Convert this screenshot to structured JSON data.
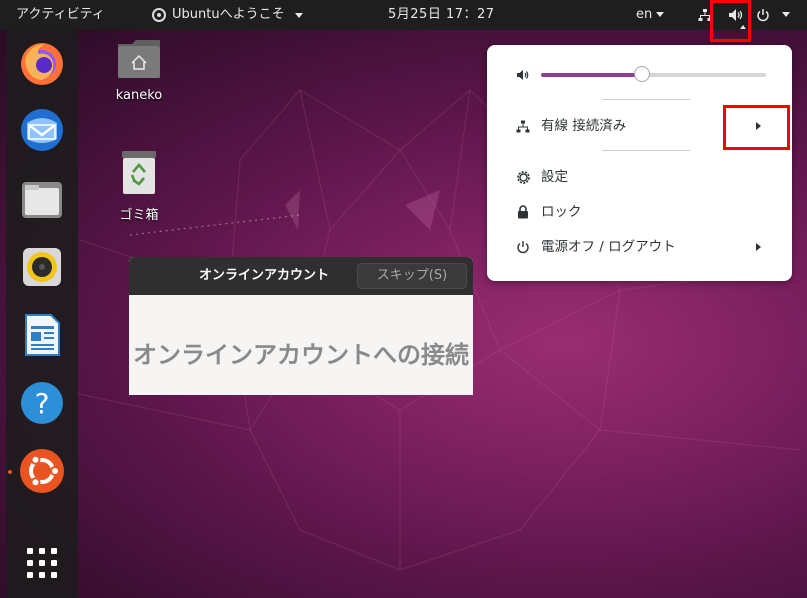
{
  "topbar": {
    "activities": "アクティビティ",
    "app_menu": "Ubuntuへようこそ",
    "clock": "5月25日  17：27",
    "lang": "en"
  },
  "desktop": {
    "home_label": "kaneko",
    "trash_label": "ゴミ箱"
  },
  "dock": {
    "items": [
      "firefox",
      "thunderbird",
      "files",
      "rhythmbox",
      "libreoffice-writer",
      "help",
      "ubuntu-software",
      "show-applications"
    ]
  },
  "online_accounts": {
    "title": "オンラインアカウント",
    "skip_label": "スキップ(S)",
    "heading": "オンラインアカウントへの接続"
  },
  "system_menu": {
    "volume_level": 0.45,
    "wired": "有線 接続済み",
    "settings": "設定",
    "lock": "ロック",
    "power": "電源オフ / ログアウト"
  },
  "colors": {
    "accent": "#e95420",
    "slider": "#8b3f8f",
    "highlight": "#ff0000",
    "topbar": "#1e1e1e"
  }
}
